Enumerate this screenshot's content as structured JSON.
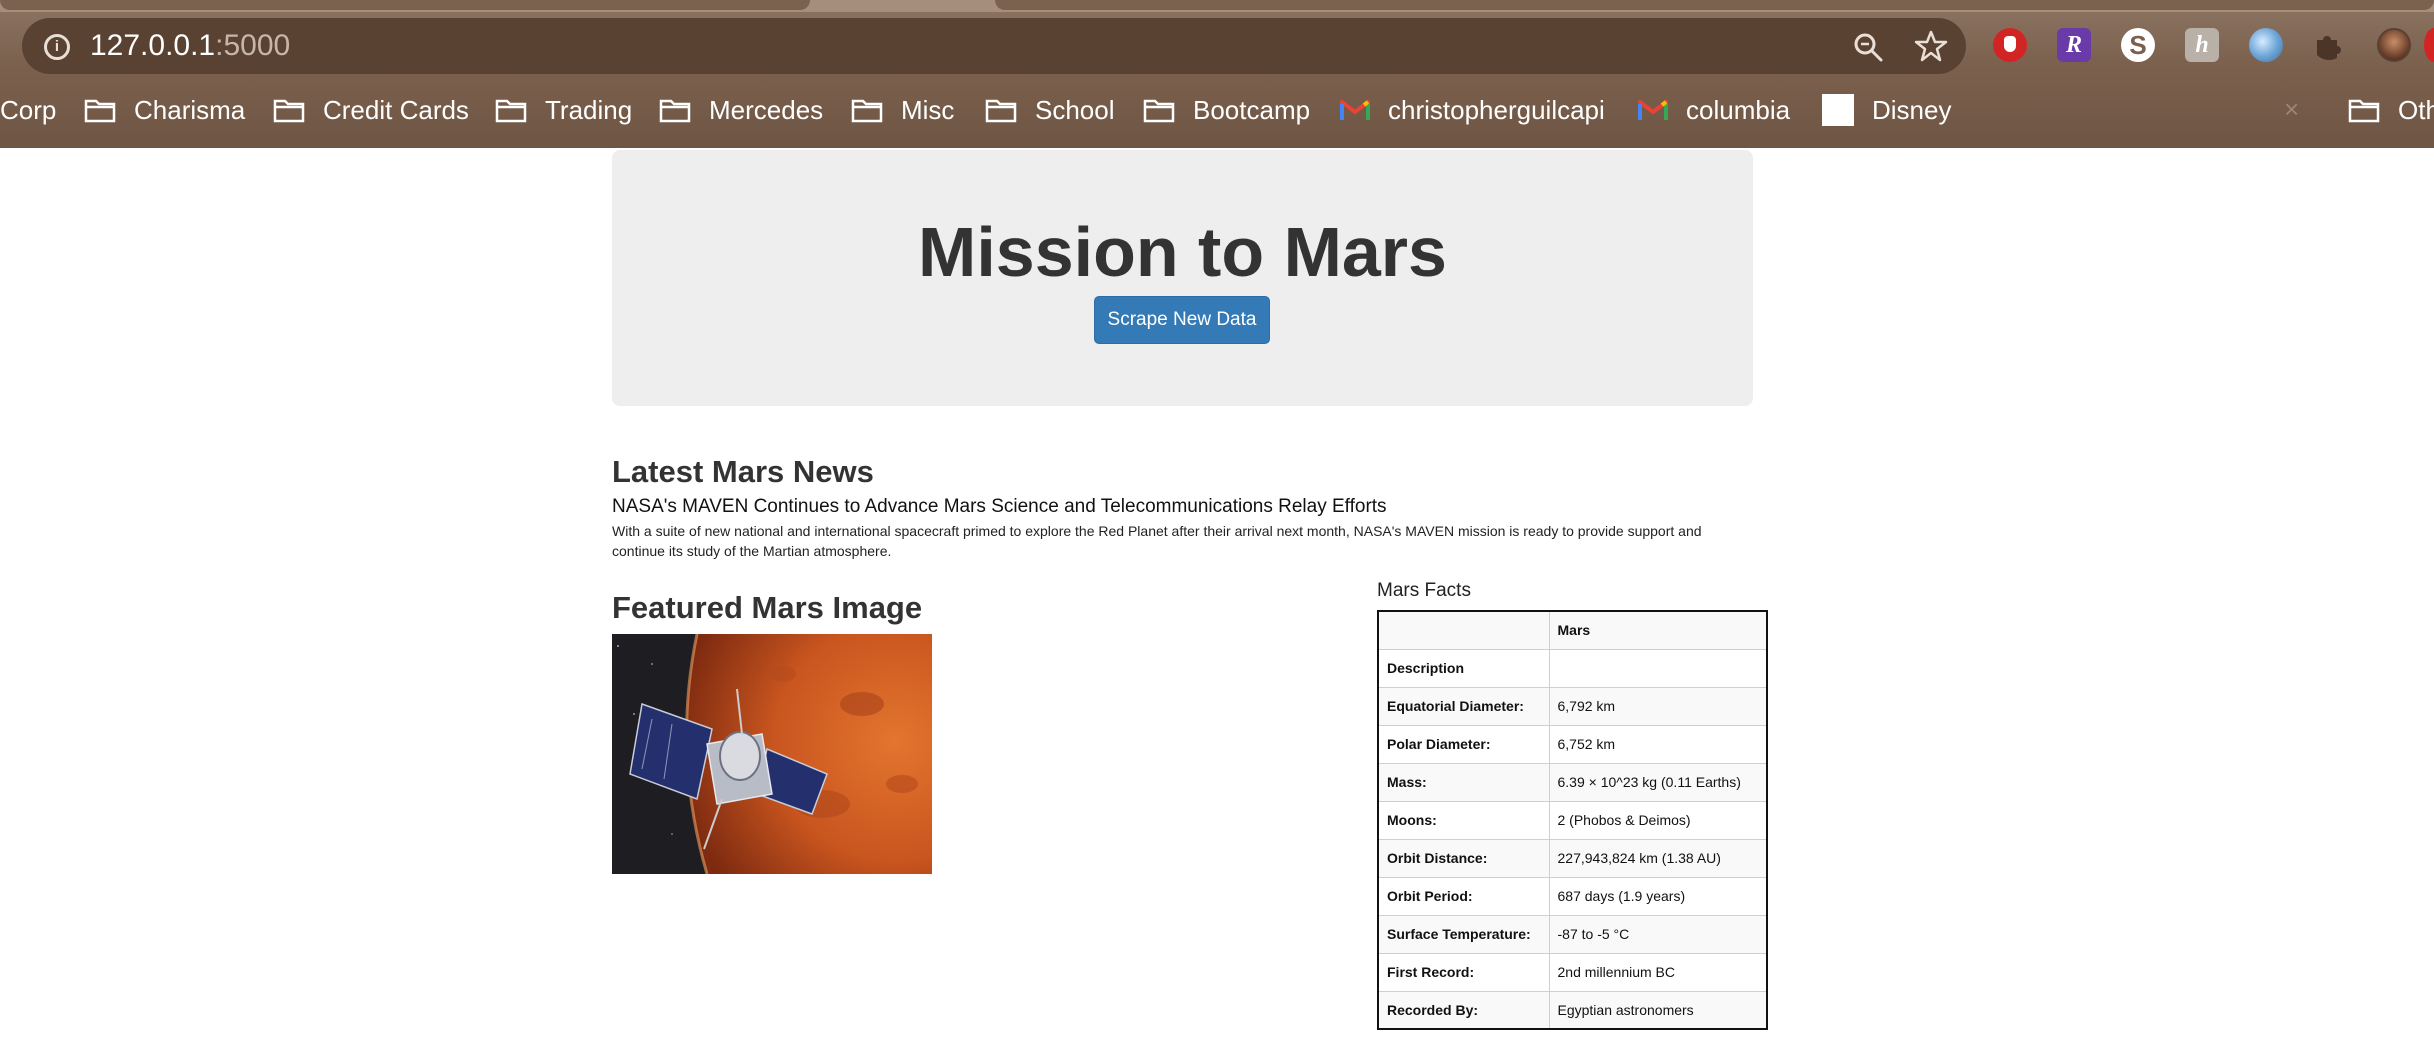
{
  "browser": {
    "url_host": "127.0.0.1",
    "url_port": ":5000",
    "bookmarks": [
      {
        "label": "Corp",
        "icon": "folder-icon"
      },
      {
        "label": "Charisma",
        "icon": "folder-icon"
      },
      {
        "label": "Credit Cards",
        "icon": "folder-icon"
      },
      {
        "label": "Trading",
        "icon": "folder-icon"
      },
      {
        "label": "Mercedes",
        "icon": "folder-icon"
      },
      {
        "label": "Misc",
        "icon": "folder-icon"
      },
      {
        "label": "School",
        "icon": "folder-icon"
      },
      {
        "label": "Bootcamp",
        "icon": "folder-icon"
      },
      {
        "label": "christopherguilcapi",
        "icon": "gmail-icon"
      },
      {
        "label": "columbia",
        "icon": "gmail-icon"
      },
      {
        "label": "Disney",
        "icon": "disney-icon"
      },
      {
        "label": "Oth",
        "icon": "folder-icon"
      }
    ],
    "extension_letters": {
      "r": "R",
      "s": "S",
      "h": "h"
    }
  },
  "jumbotron": {
    "title": "Mission to Mars",
    "button_label": "Scrape New Data",
    "button_color": "#337ab7"
  },
  "news": {
    "heading": "Latest Mars News",
    "title": "NASA's MAVEN Continues to Advance Mars Science and Telecommunications Relay Efforts",
    "teaser": "With a suite of new national and international spacecraft primed to explore the Red Planet after their arrival next month, NASA's MAVEN mission is ready to provide support and continue its study of the Martian atmosphere."
  },
  "featured": {
    "heading": "Featured Mars Image"
  },
  "facts": {
    "heading": "Mars Facts",
    "column_header": "Mars",
    "rows": [
      {
        "label": "Description",
        "value": ""
      },
      {
        "label": "Equatorial Diameter:",
        "value": "6,792 km"
      },
      {
        "label": "Polar Diameter:",
        "value": "6,752 km"
      },
      {
        "label": "Mass:",
        "value": "6.39 × 10^23 kg (0.11 Earths)"
      },
      {
        "label": "Moons:",
        "value": "2 (Phobos & Deimos)"
      },
      {
        "label": "Orbit Distance:",
        "value": "227,943,824 km (1.38 AU)"
      },
      {
        "label": "Orbit Period:",
        "value": "687 days (1.9 years)"
      },
      {
        "label": "Surface Temperature:",
        "value": "-87 to -5 °C"
      },
      {
        "label": "First Record:",
        "value": "2nd millennium BC"
      },
      {
        "label": "Recorded By:",
        "value": "Egyptian astronomers"
      }
    ]
  }
}
